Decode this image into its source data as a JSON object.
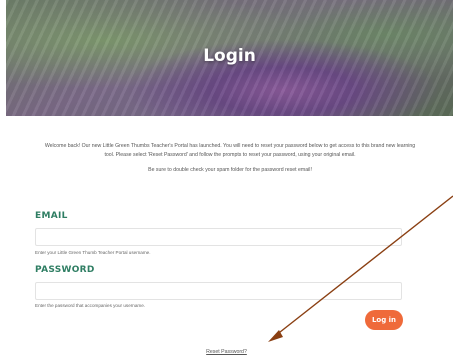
{
  "hero": {
    "title": "Login"
  },
  "intro": {
    "paragraph": "Welcome back! Our new Little Green Thumbs Teacher's Portal has launched. You will need to reset your password below to get access to this brand new learning tool. Please select 'Reset Password' and follow the prompts to reset your password, using your original email.",
    "note": "Be sure to double check your spam folder for the password reset email!"
  },
  "form": {
    "email_label": "EMAIL",
    "email_value": "",
    "email_hint": "Enter your Little Green Thumb Teacher Portal username.",
    "password_label": "PASSWORD",
    "password_value": "",
    "password_hint": "Enter the password that accompanies your username.",
    "login_label": "Log in",
    "reset_label": "Reset Password?"
  },
  "colors": {
    "label_green": "#2f7e63",
    "button_orange": "#ef6a3a",
    "arrow_brown": "#8a3f12"
  }
}
